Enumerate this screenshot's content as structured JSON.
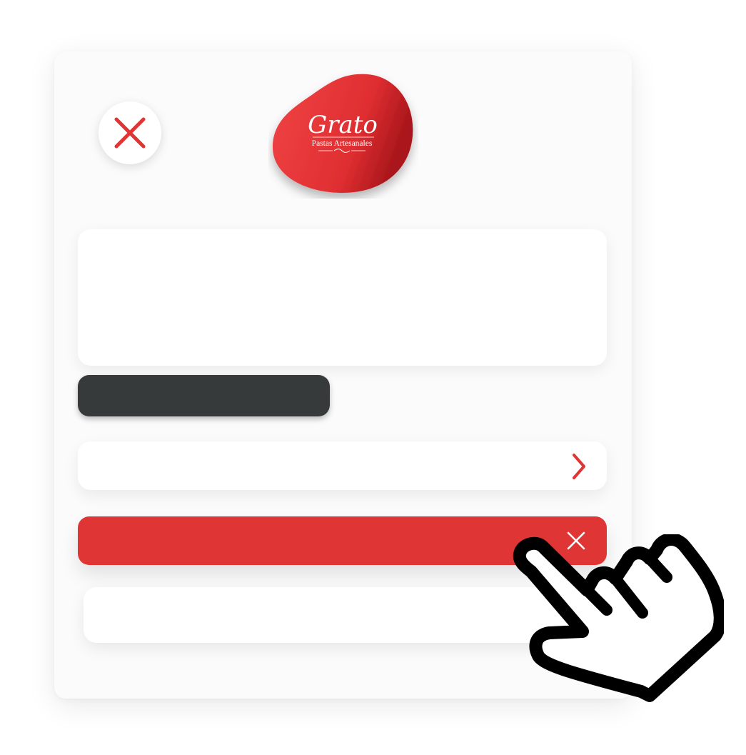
{
  "brand": {
    "name": "Grato",
    "tagline": "Pastas Artesanales",
    "color": "#e03535"
  },
  "icons": {
    "close": "close-icon",
    "next": "chevron-right-icon",
    "dismiss": "x-icon",
    "pointer": "hand-pointer-icon"
  },
  "colors": {
    "accent": "#e03535",
    "dark_pill": "#363a3b",
    "modal_bg": "#fbfbfb"
  }
}
